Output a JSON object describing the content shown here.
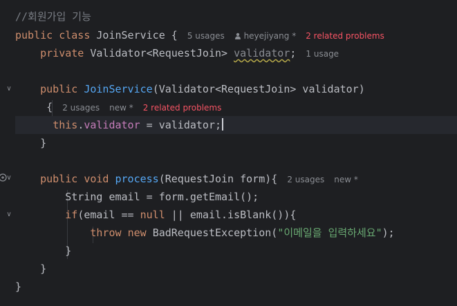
{
  "code": {
    "comment": "//회원가입 기능",
    "kw_public": "public",
    "kw_class": "class",
    "class_name": "JoinService",
    "brace_open": "{",
    "brace_close": "}",
    "kw_private": "private",
    "field_type": "Validator<RequestJoin>",
    "field_name": "validator",
    "semicolon": ";",
    "ctor_name": "JoinService",
    "ctor_params": "(Validator<RequestJoin> validator)",
    "kw_this": "this",
    "this_field": "validator",
    "assign_rhs": " = validator;",
    "kw_void": "void",
    "method_name": "process",
    "method_params": "(RequestJoin form){",
    "line_email": "String email = form.getEmail();",
    "kw_if": "if",
    "if_cond_a": "(email == ",
    "kw_null": "null",
    "if_cond_b": " || email.isBlank()){",
    "kw_throw": "throw",
    "kw_new": "new",
    "exception_call": "BadRequestException(",
    "exception_message": "\"이메일을 입력하세요\"",
    "exception_end": ");"
  },
  "hints": {
    "class_usages": "5 usages",
    "class_author": "heyejiyang *",
    "class_problems": "2 related problems",
    "field_usages": "1 usage",
    "ctor_usages": "2 usages",
    "ctor_new": "new *",
    "ctor_problems": "2 related problems",
    "method_usages": "2 usages",
    "method_new": "new *"
  },
  "colors": {
    "background": "#1e1f22",
    "keyword": "#cf8e6d",
    "function": "#56a8f5",
    "field": "#c77dbb",
    "string": "#6aab73",
    "problem": "#f75464"
  },
  "icons": [
    "person-icon",
    "fold-arrow-icon",
    "override-icon"
  ]
}
